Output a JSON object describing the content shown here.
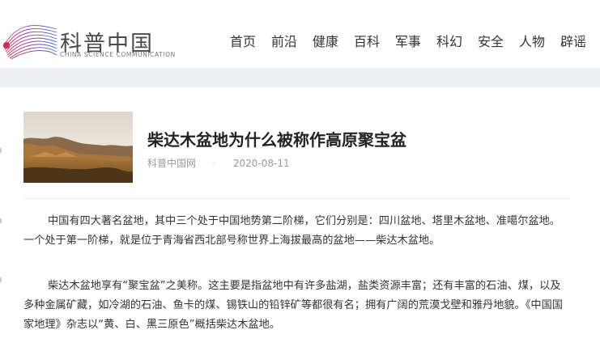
{
  "site": {
    "name": "科普中国",
    "subtitle": "CHINA SCIENCE COMMUNICATION"
  },
  "nav": {
    "items": [
      {
        "label": "首页"
      },
      {
        "label": "前沿"
      },
      {
        "label": "健康"
      },
      {
        "label": "百科"
      },
      {
        "label": "军事"
      },
      {
        "label": "科幻"
      },
      {
        "label": "安全"
      },
      {
        "label": "人物"
      },
      {
        "label": "辟谣"
      }
    ]
  },
  "article": {
    "title": "柴达木盆地为什么被称作高原聚宝盆",
    "source": "科普中国网",
    "date": "2020-08-11",
    "paragraphs": [
      "中国有四大著名盆地，其中三个处于中国地势第二阶梯，它们分别是：四川盆地、塔里木盆地、准噶尔盆地。一个处于第一阶梯，就是位于青海省西北部号称世界上海拔最高的盆地——柴达木盆地。",
      "柴达木盆地享有“聚宝盆”之美称。这主要是指盆地中有许多盐湖，盐类资源丰富；还有丰富的石油、煤，以及多种金属矿藏，如冷湖的石油、鱼卡的煤、锡铁山的铅锌矿等都很有名；拥有广阔的荒漠戈壁和雅丹地貌。《中国国家地理》杂志以“黄、白、黑三原色”概括柴达木盆地。"
    ]
  },
  "colors": {
    "accent": "#6b3fa0",
    "page_bg": "#f3f4f6",
    "band_bg": "#eceef2"
  }
}
